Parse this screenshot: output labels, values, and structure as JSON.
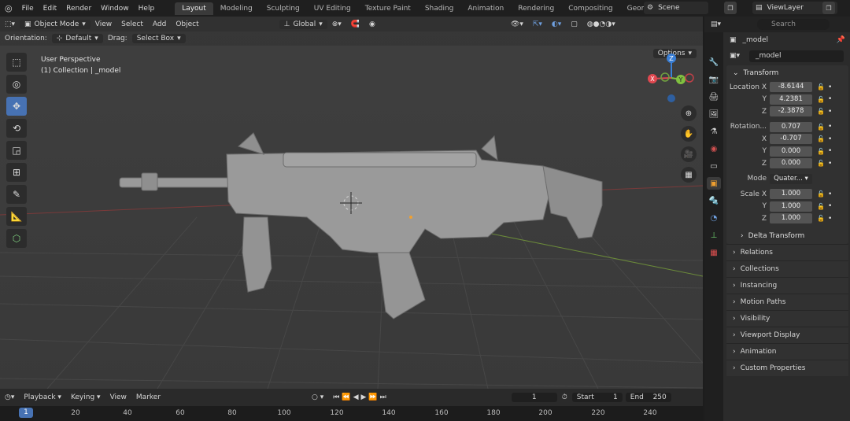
{
  "topbar": {
    "menus": [
      "File",
      "Edit",
      "Render",
      "Window",
      "Help"
    ],
    "workspaces": [
      "Layout",
      "Modeling",
      "Sculpting",
      "UV Editing",
      "Texture Paint",
      "Shading",
      "Animation",
      "Rendering",
      "Compositing",
      "Geometry Node"
    ],
    "active_workspace": "Layout",
    "scene": "Scene",
    "view_layer": "ViewLayer"
  },
  "viewport": {
    "mode": "Object Mode",
    "menus": [
      "View",
      "Select",
      "Add",
      "Object"
    ],
    "transform_orientation": "Global",
    "orientation_label": "Orientation:",
    "orientation_value": "Default",
    "drag_label": "Drag:",
    "drag_value": "Select Box",
    "options_label": "Options",
    "info_line1": "User Perspective",
    "info_line2": "(1) Collection | _model",
    "gizmo_labels": {
      "z": "Z",
      "y": "Y",
      "x": "X"
    }
  },
  "timeline": {
    "playback": "Playback",
    "keying": "Keying",
    "view": "View",
    "marker": "Marker",
    "current_frame": "1",
    "start_label": "Start",
    "start": "1",
    "end_label": "End",
    "end": "250",
    "ruler_current": "1",
    "ruler_ticks": [
      "20",
      "40",
      "60",
      "80",
      "100",
      "120",
      "140",
      "160",
      "180",
      "200",
      "220",
      "240"
    ]
  },
  "properties": {
    "search_placeholder": "Search",
    "object_name": "_model",
    "data_name": "_model",
    "transform_title": "Transform",
    "location": {
      "label": "Location X",
      "x": "-8.6144",
      "y": "4.2381",
      "z": "-2.3878"
    },
    "rotation": {
      "label": "Rotation...",
      "w": "0.707",
      "x": "-0.707",
      "y": "0.000",
      "z": "0.000"
    },
    "mode_label": "Mode",
    "mode_value": "Quater...",
    "scale": {
      "label": "Scale X",
      "x": "1.000",
      "y": "1.000",
      "z": "1.000"
    },
    "axis_labels": {
      "x": "X",
      "y": "Y",
      "z": "Z"
    },
    "delta_transform": "Delta Transform",
    "sections": [
      "Relations",
      "Collections",
      "Instancing",
      "Motion Paths",
      "Visibility",
      "Viewport Display",
      "Animation",
      "Custom Properties"
    ]
  }
}
